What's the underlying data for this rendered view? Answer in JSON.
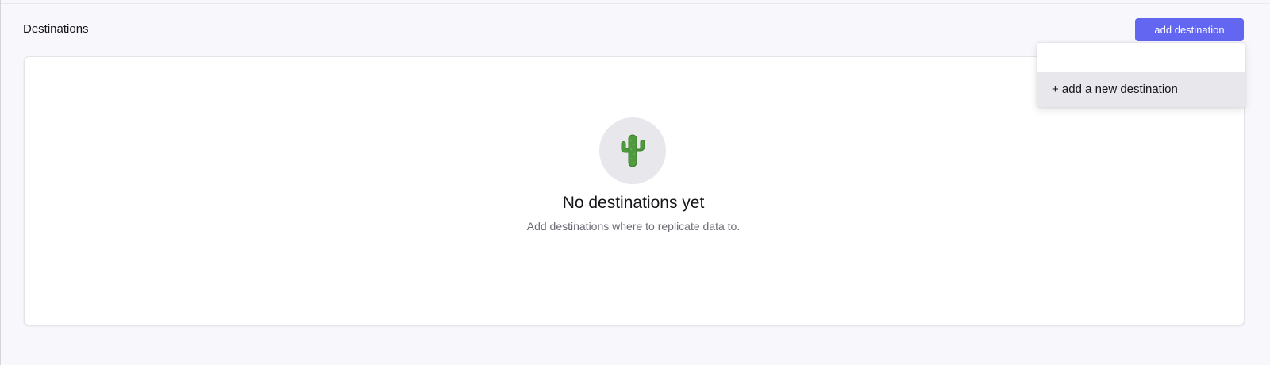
{
  "header": {
    "title": "Destinations",
    "add_button_label": "add destination"
  },
  "dropdown": {
    "search_value": "",
    "items": [
      {
        "label": "+ add a new destination"
      }
    ]
  },
  "empty_state": {
    "icon": "cactus-icon",
    "title": "No destinations yet",
    "subtitle": "Add destinations where to replicate data to."
  },
  "colors": {
    "accent": "#6366f1",
    "background": "#f8f8fc",
    "icon_circle": "#e8e8ec",
    "cactus": "#4f9a3c"
  }
}
